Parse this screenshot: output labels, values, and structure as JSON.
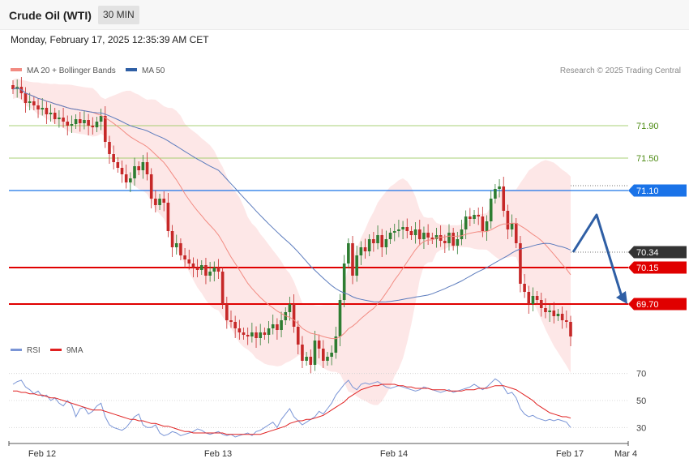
{
  "header": {
    "title": "Crude Oil (WTI)",
    "timeframe": "30 MIN",
    "datetime": "Monday, February 17, 2025 12:35:39 AM CET"
  },
  "legend": {
    "ma20": "MA 20 + Bollinger Bands",
    "ma50": "MA 50",
    "copyright": "Research © 2025 Trading Central",
    "rsi": "RSI",
    "rsi_ma": "9MA"
  },
  "colors": {
    "up": "#2e7d32",
    "down": "#c62828",
    "ma20": "#f28b82",
    "ma50": "#5b7bbd",
    "band": "#fde3e3",
    "resistance": "#8bc34a",
    "pivot": "#1a73e8",
    "support": "#e00000",
    "arrow": "#2f5fa5",
    "rsi": "#7a95d6",
    "rsi_ma": "#e02020"
  },
  "chart_data": [
    {
      "type": "candlestick",
      "title": "Crude Oil (WTI)",
      "timeframe": "30 MIN",
      "x_ticks": [
        "Feb 12",
        "Feb 13",
        "Feb 14",
        "Feb 17",
        "Mar 4"
      ],
      "ylim": [
        69.25,
        72.35
      ],
      "levels": [
        {
          "value": 71.9,
          "label": "71.90",
          "role": "resistance"
        },
        {
          "value": 71.5,
          "label": "71.50",
          "role": "resistance"
        },
        {
          "value": 71.1,
          "label": "71.10",
          "role": "pivot"
        },
        {
          "value": 70.15,
          "label": "70.15",
          "role": "support"
        },
        {
          "value": 69.7,
          "label": "69.70",
          "role": "support"
        }
      ],
      "last_price": {
        "value": 70.34,
        "label": "70.34"
      },
      "close": [
        72.35,
        72.38,
        72.3,
        72.18,
        72.2,
        72.15,
        72.1,
        72.12,
        72.04,
        72.06,
        71.98,
        72.0,
        71.95,
        71.9,
        71.92,
        71.98,
        71.93,
        71.97,
        71.9,
        71.88,
        71.95,
        72.02,
        71.7,
        71.55,
        71.45,
        71.38,
        71.3,
        71.2,
        71.25,
        71.4,
        71.35,
        71.45,
        71.3,
        71.0,
        70.92,
        71.0,
        70.95,
        70.6,
        70.4,
        70.45,
        70.3,
        70.25,
        70.2,
        70.15,
        70.12,
        70.18,
        70.05,
        70.1,
        70.15,
        70.1,
        69.7,
        69.5,
        69.48,
        69.4,
        69.35,
        69.32,
        69.3,
        69.35,
        69.28,
        69.35,
        69.32,
        69.4,
        69.45,
        69.38,
        69.5,
        69.6,
        69.7,
        69.42,
        69.2,
        69.0,
        69.05,
        68.95,
        69.25,
        69.15,
        69.0,
        69.05,
        69.1,
        69.3,
        69.75,
        70.2,
        70.45,
        70.05,
        70.3,
        70.4,
        70.35,
        70.5,
        70.45,
        70.55,
        70.4,
        70.5,
        70.58,
        70.6,
        70.62,
        70.65,
        70.6,
        70.55,
        70.62,
        70.5,
        70.58,
        70.52,
        70.5,
        70.55,
        70.48,
        70.45,
        70.58,
        70.42,
        70.5,
        70.62,
        70.78,
        70.75,
        70.8,
        70.78,
        70.6,
        70.72,
        71.0,
        71.12,
        71.15,
        70.85,
        70.62,
        70.7,
        70.45,
        69.95,
        69.85,
        69.7,
        69.8,
        69.75,
        69.65,
        69.6,
        69.62,
        69.55,
        69.58,
        69.5,
        69.48,
        69.3
      ]
    },
    {
      "type": "line",
      "title": "RSI",
      "series_names": [
        "RSI",
        "9MA"
      ],
      "yticks": [
        70,
        50,
        30
      ],
      "ylim": [
        20,
        80
      ],
      "rsi": [
        62,
        64,
        65,
        60,
        58,
        55,
        57,
        53,
        54,
        50,
        52,
        48,
        46,
        50,
        47,
        38,
        44,
        45,
        40,
        42,
        46,
        48,
        38,
        32,
        30,
        29,
        28,
        30,
        34,
        38,
        40,
        32,
        30,
        30,
        32,
        26,
        24,
        25,
        27,
        26,
        24,
        25,
        26,
        27,
        29,
        28,
        26,
        25,
        26,
        27,
        25,
        24,
        25,
        23,
        24,
        25,
        26,
        24,
        27,
        28,
        30,
        32,
        34,
        30,
        36,
        40,
        44,
        38,
        35,
        32,
        34,
        36,
        38,
        42,
        40,
        44,
        48,
        54,
        58,
        62,
        65,
        60,
        58,
        62,
        63,
        62,
        63,
        64,
        62,
        60,
        59,
        60,
        61,
        60,
        59,
        58,
        57,
        58,
        60,
        59,
        58,
        57,
        56,
        57,
        58,
        56,
        57,
        58,
        59,
        60,
        62,
        60,
        58,
        60,
        63,
        66,
        64,
        60,
        55,
        56,
        52,
        44,
        40,
        38,
        39,
        37,
        36,
        35,
        36,
        35,
        36,
        35,
        34,
        30
      ],
      "ma": [
        57,
        57,
        56,
        56,
        55,
        55,
        54,
        54,
        53,
        52,
        52,
        51,
        50,
        49,
        48,
        47,
        46,
        45,
        44,
        43,
        43,
        43,
        42,
        41,
        40,
        39,
        38,
        37,
        36,
        36,
        35,
        35,
        34,
        33,
        33,
        32,
        31,
        31,
        30,
        29,
        28,
        27,
        27,
        26,
        26,
        26,
        26,
        26,
        26,
        26,
        26,
        25,
        25,
        25,
        25,
        25,
        25,
        25,
        25,
        25,
        26,
        27,
        28,
        29,
        30,
        31,
        33,
        34,
        35,
        35,
        36,
        36,
        37,
        38,
        39,
        41,
        43,
        45,
        47,
        49,
        52,
        54,
        56,
        58,
        59,
        60,
        61,
        61,
        62,
        62,
        62,
        62,
        61,
        61,
        60,
        60,
        59,
        59,
        59,
        59,
        58,
        58,
        58,
        58,
        57,
        57,
        57,
        57,
        58,
        58,
        58,
        59,
        59,
        59,
        60,
        61,
        61,
        61,
        60,
        59,
        58,
        56,
        54,
        52,
        50,
        47,
        45,
        43,
        41,
        40,
        39,
        38,
        38,
        37
      ]
    }
  ]
}
